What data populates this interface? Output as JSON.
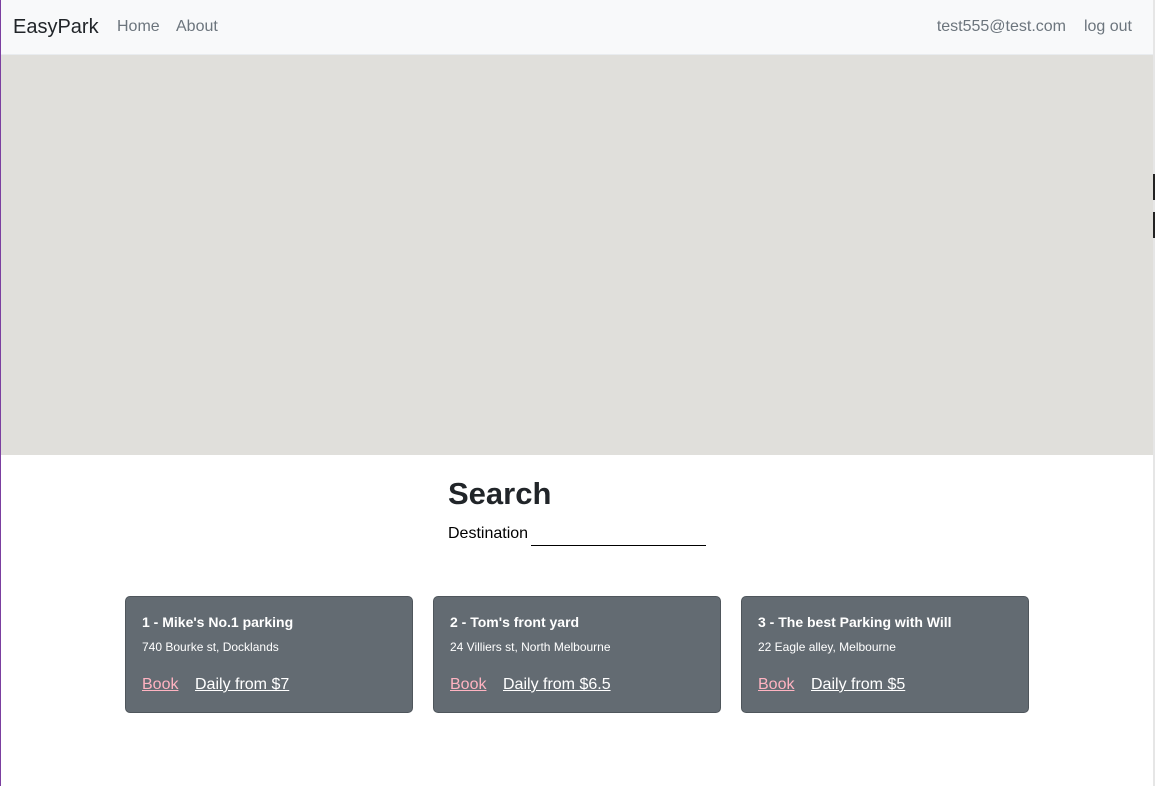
{
  "navbar": {
    "brand": "EasyPark",
    "links": [
      "Home",
      "About"
    ],
    "user_email": "test555@test.com",
    "logout": "log out"
  },
  "search": {
    "title": "Search",
    "destination_label": "Destination",
    "destination_value": ""
  },
  "parkings": [
    {
      "title": "1 - Mike's No.1 parking",
      "address": "740 Bourke st, Docklands",
      "book": "Book",
      "price": "Daily from $7"
    },
    {
      "title": "2 - Tom's front yard",
      "address": "24 Villiers st, North Melbourne",
      "book": "Book",
      "price": "Daily from $6.5"
    },
    {
      "title": "3 - The best Parking with Will",
      "address": "22 Eagle alley, Melbourne",
      "book": "Book",
      "price": "Daily from $5"
    }
  ],
  "colors": {
    "navbar_bg": "#f8f9fa",
    "map_bg": "#e0dfdb",
    "card_bg": "#636b72",
    "book_link": "#ffb3c1"
  }
}
